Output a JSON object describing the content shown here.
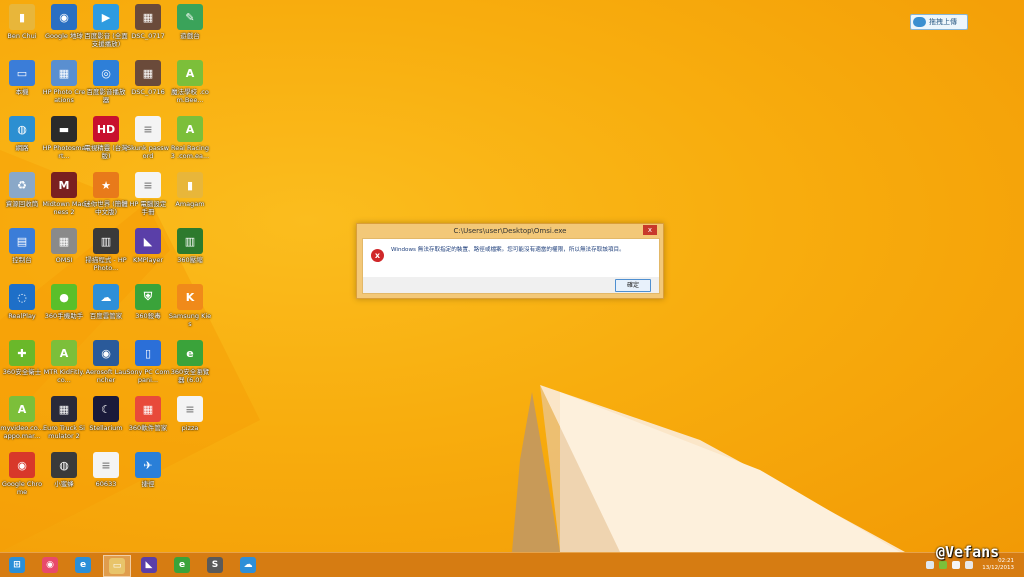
{
  "desktop": {
    "icons": [
      {
        "label": "Ben Chui",
        "color": "#e8b63a",
        "glyph": "▮"
      },
      {
        "label": "Google 地球",
        "color": "#2a6fc2",
        "glyph": "◉"
      },
      {
        "label": "百度影音 (全面支援播放)",
        "color": "#2e9be0",
        "glyph": "▶"
      },
      {
        "label": "DSC_0717",
        "color": "#6a4a3a",
        "glyph": "▦"
      },
      {
        "label": "遊戲台",
        "color": "#3aa35a",
        "glyph": "✎"
      },
      {
        "label": "本機",
        "color": "#3b7dd8",
        "glyph": "▭"
      },
      {
        "label": "HP Photo Creations",
        "color": "#5a8fd0",
        "glyph": "▦"
      },
      {
        "label": "百度影音播放器",
        "color": "#2e7fd8",
        "glyph": "◎"
      },
      {
        "label": "DSC_0716",
        "color": "#6a4a3a",
        "glyph": "▦"
      },
      {
        "label": "魔法學校 .com.Bee...",
        "color": "#7cbf3a",
        "glyph": "A"
      },
      {
        "label": "網路",
        "color": "#2c8fd1",
        "glyph": "◍"
      },
      {
        "label": "HP Photosmart...",
        "color": "#2b2b2b",
        "glyph": "▬"
      },
      {
        "label": "電視精靈 (台灣版)",
        "color": "#c8102e",
        "glyph": "HD"
      },
      {
        "label": "Skunk password",
        "color": "#f4f4f4",
        "glyph": "≡"
      },
      {
        "label": "Real Racing 3 .com.ea...",
        "color": "#7cbf3a",
        "glyph": "A"
      },
      {
        "label": "資源回收筒",
        "color": "#8aa8c8",
        "glyph": "♻"
      },
      {
        "label": "Midtown Madness 2",
        "color": "#7a2020",
        "glyph": "M"
      },
      {
        "label": "迷你世界 (簡體中文版)",
        "color": "#e87a1a",
        "glyph": "★"
      },
      {
        "label": "HP 電腦設定 手冊",
        "color": "#f4f4f4",
        "glyph": "≡"
      },
      {
        "label": "Amagam",
        "color": "#e8b63a",
        "glyph": "▮"
      },
      {
        "label": "控制台",
        "color": "#3b7dd8",
        "glyph": "▤"
      },
      {
        "label": "OMSI",
        "color": "#8a8a8a",
        "glyph": "▦"
      },
      {
        "label": "掃描程式 - HP Photo...",
        "color": "#3a3a3a",
        "glyph": "▥"
      },
      {
        "label": "KMPlayer",
        "color": "#5a3fa8",
        "glyph": "◣"
      },
      {
        "label": "360壓縮",
        "color": "#2d7a2d",
        "glyph": "▥"
      },
      {
        "label": "RealPlay",
        "color": "#1e6fc8",
        "glyph": "◌"
      },
      {
        "label": "360手機助手",
        "color": "#5abf2a",
        "glyph": "●"
      },
      {
        "label": "百度雲管家",
        "color": "#2e8fd8",
        "glyph": "☁"
      },
      {
        "label": "360殺毒",
        "color": "#3aa33a",
        "glyph": "⛨"
      },
      {
        "label": "Samsung Kies",
        "color": "#f08a1a",
        "glyph": "K"
      },
      {
        "label": "360安全衛士",
        "color": "#6ab82a",
        "glyph": "✚"
      },
      {
        "label": "MTR KidFitly.co...",
        "color": "#7cbf3a",
        "glyph": "A"
      },
      {
        "label": "Aerosoft Launcher",
        "color": "#2a5a9a",
        "glyph": "◉"
      },
      {
        "label": "Sony PC Compani...",
        "color": "#2b6fd8",
        "glyph": "▯"
      },
      {
        "label": "360安全瀏覽器 (6.0)",
        "color": "#3aa33a",
        "glyph": "e"
      },
      {
        "label": "myvideo.co...appo.mar...",
        "color": "#7cbf3a",
        "glyph": "A"
      },
      {
        "label": "Euro Truck Simulator 2",
        "color": "#2a2a3a",
        "glyph": "▦"
      },
      {
        "label": "Stellarium",
        "color": "#1a1a3a",
        "glyph": "☾"
      },
      {
        "label": "360軟件管家",
        "color": "#e84a3a",
        "glyph": "▦"
      },
      {
        "label": "pizza",
        "color": "#f4f4f4",
        "glyph": "≡"
      },
      {
        "label": "Google Chrome",
        "color": "#d8382a",
        "glyph": "◉"
      },
      {
        "label": "小蜜蜂",
        "color": "#3a3a3a",
        "glyph": "◍"
      },
      {
        "label": "60633",
        "color": "#f4f4f4",
        "glyph": "≡"
      },
      {
        "label": "捷徑",
        "color": "#2a7fd8",
        "glyph": "✈"
      }
    ]
  },
  "upload_button": {
    "label": "拖拽上傳"
  },
  "dialog": {
    "title": "C:\\Users\\user\\Desktop\\Omsi.exe",
    "close_glyph": "x",
    "error_glyph": "x",
    "message": "Windows 無法存取指定的裝置、路徑或檔案。您可能沒有適當的權限，所以無法存取該項目。",
    "ok_label": "確定"
  },
  "taskbar": {
    "apps": [
      {
        "name": "start",
        "color": "#2a8fd8",
        "glyph": "⊞"
      },
      {
        "name": "baidu",
        "color": "#e84a6a",
        "glyph": "◉"
      },
      {
        "name": "ie",
        "color": "#2a8fd8",
        "glyph": "e"
      },
      {
        "name": "explorer",
        "color": "#e8c46a",
        "glyph": "▭"
      },
      {
        "name": "kmplayer",
        "color": "#5a3fa8",
        "glyph": "◣"
      },
      {
        "name": "360browser",
        "color": "#3aa33a",
        "glyph": "e"
      },
      {
        "name": "sublime",
        "color": "#5a5a5a",
        "glyph": "S"
      },
      {
        "name": "baiduyun",
        "color": "#2e8fd8",
        "glyph": "☁"
      }
    ],
    "clock": {
      "time": "02:21",
      "date": "13/12/2013"
    }
  },
  "watermark": "@Vefans"
}
